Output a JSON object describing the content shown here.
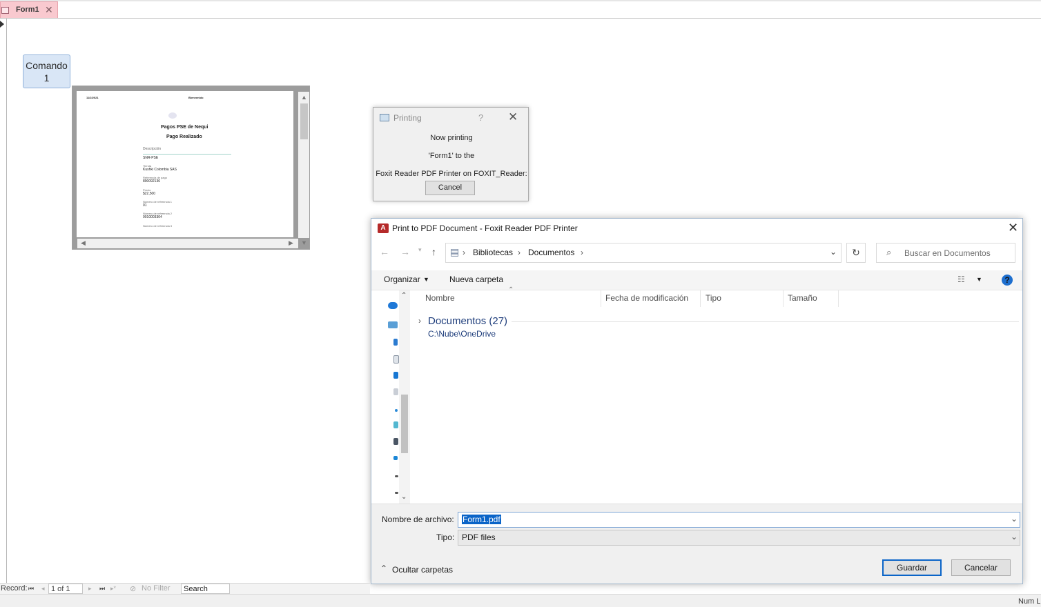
{
  "access": {
    "tab_label": "Form1",
    "command_button_line1": "Comando",
    "command_button_line2": "1",
    "nav": {
      "record_label": "Record:",
      "record_value": "1 of 1",
      "filter_label": "No Filter",
      "search_label": "Search"
    },
    "status_text": "Num L"
  },
  "embedded_page": {
    "header_left": "11/2/2021",
    "header_right": "Bienvenido",
    "title": "Pagos PSE de Nequi",
    "subtitle": "Pago Realizado",
    "section": "Descripción",
    "fields": [
      {
        "label": "",
        "value": "SNR-PSE"
      },
      {
        "label": "Tienda",
        "value": "Kushki Colombia SAS"
      },
      {
        "label": "Referencia de pago",
        "value": "890092136"
      },
      {
        "label": "Precio",
        "value": "$22,500"
      },
      {
        "label": "Número de referencia 1",
        "value": "01"
      },
      {
        "label": "Número de referencia 2",
        "value": "9010003304"
      },
      {
        "label": "Número de referencia 3",
        "value": ""
      }
    ]
  },
  "printing_dialog": {
    "title": "Printing",
    "help_glyph": "?",
    "line1": "Now printing",
    "line2": "'Form1' to the",
    "line3": "Foxit Reader PDF Printer on FOXIT_Reader:",
    "cancel_label": "Cancel"
  },
  "save_dialog": {
    "title": "Print to PDF Document - Foxit Reader PDF Printer",
    "breadcrumb": [
      "Bibliotecas",
      "Documentos"
    ],
    "search_placeholder": "Buscar en Documentos",
    "toolbar": {
      "organize": "Organizar",
      "new_folder": "Nueva carpeta"
    },
    "columns": [
      "Nombre",
      "Fecha de modificación",
      "Tipo",
      "Tamaño"
    ],
    "group": {
      "name": "Documentos (27)",
      "path": "C:\\Nube\\OneDrive"
    },
    "filename_label": "Nombre de archivo:",
    "filename_value": "Form1.pdf",
    "type_label": "Tipo:",
    "type_value": "PDF files",
    "hide_folders": "Ocultar carpetas",
    "save_label": "Guardar",
    "cancel_label": "Cancelar"
  },
  "colors": {
    "tab": "#f9c9cf",
    "accent": "#0a64c8",
    "button": "#d9e6f6"
  }
}
